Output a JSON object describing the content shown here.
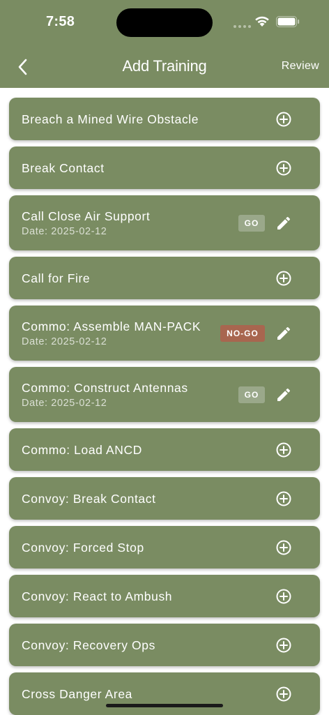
{
  "status_bar": {
    "time": "7:58"
  },
  "nav": {
    "title": "Add Training",
    "review_label": "Review"
  },
  "badge_colors": {
    "go": "#9aa88a",
    "no_go": "#a8664f",
    "card": "#7a8c62"
  },
  "items": [
    {
      "title": "Breach a Mined Wire Obstacle",
      "date": "",
      "status": "",
      "action": "add"
    },
    {
      "title": "Break Contact",
      "date": "",
      "status": "",
      "action": "add"
    },
    {
      "title": "Call Close Air Support",
      "date": "Date: 2025-02-12",
      "status": "GO",
      "action": "edit"
    },
    {
      "title": "Call for Fire",
      "date": "",
      "status": "",
      "action": "add"
    },
    {
      "title": "Commo: Assemble MAN-PACK",
      "date": "Date: 2025-02-12",
      "status": "NO-GO",
      "action": "edit"
    },
    {
      "title": "Commo: Construct Antennas",
      "date": "Date: 2025-02-12",
      "status": "GO",
      "action": "edit"
    },
    {
      "title": "Commo: Load ANCD",
      "date": "",
      "status": "",
      "action": "add"
    },
    {
      "title": "Convoy: Break Contact",
      "date": "",
      "status": "",
      "action": "add"
    },
    {
      "title": "Convoy: Forced Stop",
      "date": "",
      "status": "",
      "action": "add"
    },
    {
      "title": "Convoy: React to Ambush",
      "date": "",
      "status": "",
      "action": "add"
    },
    {
      "title": "Convoy: Recovery Ops",
      "date": "",
      "status": "",
      "action": "add"
    },
    {
      "title": "Cross Danger Area",
      "date": "",
      "status": "",
      "action": "add"
    }
  ]
}
